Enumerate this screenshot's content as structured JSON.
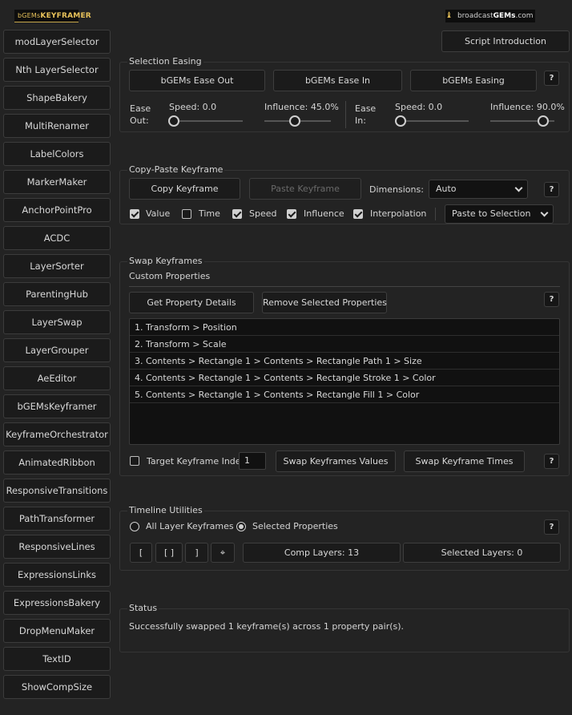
{
  "header": {
    "logo_left_small": "bGEMs",
    "logo_left_big": "KEYFRAMER",
    "logo_right_prefix": "broadcast",
    "logo_right_bold": "GEMs",
    "logo_right_suffix": ".com"
  },
  "sidebar": {
    "items": [
      "modLayerSelector",
      "Nth LayerSelector",
      "ShapeBakery",
      "MultiRenamer",
      "LabelColors",
      "MarkerMaker",
      "AnchorPointPro",
      "ACDC",
      "LayerSorter",
      "ParentingHub",
      "LayerSwap",
      "LayerGrouper",
      "AeEditor",
      "bGEMsKeyframer",
      "KeyframeOrchestrator",
      "AnimatedRibbon",
      "ResponsiveTransitions",
      "PathTransformer",
      "ResponsiveLines",
      "ExpressionsLinks",
      "ExpressionsBakery",
      "DropMenuMaker",
      "TextID",
      "ShowCompSize"
    ]
  },
  "script_intro": "Script Introduction",
  "help_label": "?",
  "selection_easing": {
    "title": "Selection Easing",
    "btn_ease_out": "bGEMs Ease Out",
    "btn_ease_in": "bGEMs Ease In",
    "btn_easing": "bGEMs Easing",
    "ease_out_label_1": "Ease",
    "ease_out_label_2": "Out:",
    "ease_in_label_1": "Ease",
    "ease_in_label_2": "In:",
    "out_speed": "Speed: 0.0",
    "out_influence": "Influence: 45.0%",
    "in_speed": "Speed: 0.0",
    "in_influence": "Influence: 90.0%",
    "out_speed_level": 0.0,
    "out_influence_level": 0.45,
    "in_speed_level": 0.0,
    "in_influence_level": 0.9
  },
  "copy_paste": {
    "title": "Copy-Paste Keyframe",
    "copy_btn": "Copy Keyframe",
    "paste_btn": "Paste Keyframe",
    "dimensions_label": "Dimensions:",
    "dimensions_value": "Auto",
    "checks": [
      {
        "label": "Value",
        "checked": true
      },
      {
        "label": "Time",
        "checked": false
      },
      {
        "label": "Speed",
        "checked": true
      },
      {
        "label": "Influence",
        "checked": true
      },
      {
        "label": "Interpolation",
        "checked": true
      }
    ],
    "paste_mode": "Paste to Selection"
  },
  "swap": {
    "title": "Swap Keyframes",
    "subtitle": "Custom Properties",
    "get_btn": "Get Property Details",
    "remove_btn": "Remove Selected Properties",
    "properties": [
      "1. Transform > Position",
      "2. Transform > Scale",
      "3. Contents > Rectangle 1 > Contents > Rectangle Path 1 > Size",
      "4. Contents > Rectangle 1 > Contents > Rectangle Stroke 1 > Color",
      "5. Contents > Rectangle 1 > Contents > Rectangle Fill 1 > Color"
    ],
    "target_label": "Target Keyframe Index:",
    "target_value": "1",
    "swap_values_btn": "Swap Keyframes Values",
    "swap_times_btn": "Swap Keyframe Times"
  },
  "timeline": {
    "title": "Timeline Utilities",
    "radio_all": "All Layer Keyframes",
    "radio_selected": "Selected Properties",
    "btn_first": "[",
    "btn_both": "[ ]",
    "btn_last": "]",
    "btn_center": "⌖",
    "comp_layers": "Comp Layers: 13",
    "selected_layers": "Selected Layers: 0"
  },
  "status": {
    "title": "Status",
    "message": "Successfully swapped 1 keyframe(s) across 1 property pair(s)."
  }
}
